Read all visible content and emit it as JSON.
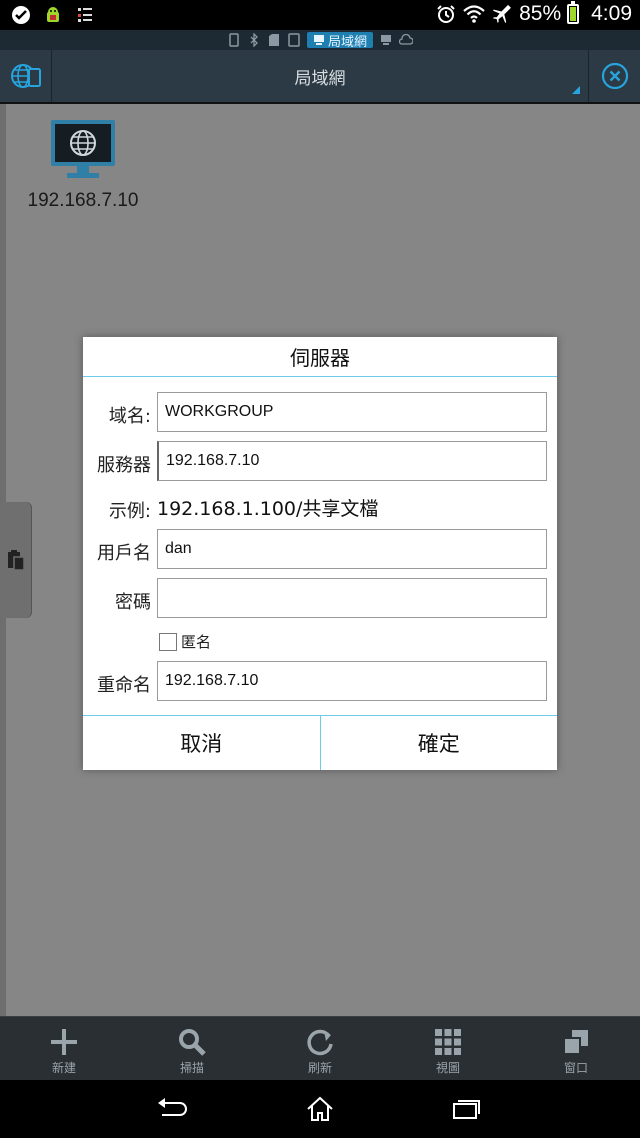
{
  "status_bar": {
    "battery_percent": "85%",
    "time": "4:09",
    "battery_level": 0.85,
    "icons_left": [
      "check-circle-icon",
      "android-debug-icon",
      "notes-icon"
    ],
    "icons_right": [
      "alarm-icon",
      "wifi-icon",
      "airplane-icon"
    ]
  },
  "tab_strip": {
    "active_label": "局域網",
    "items": [
      "phone-icon",
      "bluetooth-icon",
      "sdcard-icon",
      "tablet-icon",
      "network-icon",
      "computer-icon",
      "cloud-icon"
    ]
  },
  "title_bar": {
    "title": "局域網",
    "left_icon": "network-globe-icon",
    "right_icon": "close-circle-icon"
  },
  "content": {
    "device_label": "192.168.7.10",
    "device_icon": "computer-globe-icon"
  },
  "dialog": {
    "title": "伺服器",
    "domain_label": "域名:",
    "domain_value": "WORKGROUP",
    "server_label": "服務器",
    "server_value": "192.168.7.10",
    "example_label": "示例:",
    "example_value": "192.168.1.100/共享文檔",
    "user_label": "用戶名",
    "user_value": "dan",
    "password_label": "密碼",
    "password_value": "",
    "anonymous_label": "匿名",
    "anonymous_checked": false,
    "rename_label": "重命名",
    "rename_value": "192.168.7.10",
    "cancel_label": "取消",
    "ok_label": "確定"
  },
  "toolbar": {
    "new_label": "新建",
    "scan_label": "掃描",
    "refresh_label": "刷新",
    "view_label": "視圖",
    "window_label": "窗口"
  },
  "colors": {
    "accent": "#27a4dd",
    "dialog_divider": "#6ccbe8",
    "titlebar_bg": "#2b3a44",
    "toolbar_bg": "#2a2f33",
    "battery_green": "#9fd62b"
  }
}
